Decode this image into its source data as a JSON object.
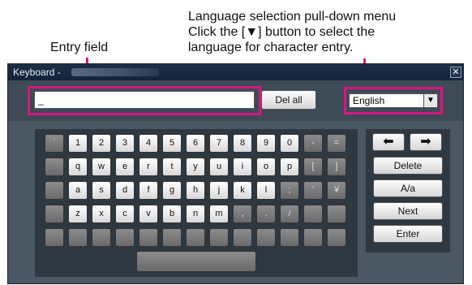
{
  "callouts": {
    "entry_field": "Entry field",
    "language_line1": "Language selection pull-down menu",
    "language_line2": "Click the [▼] button to select the",
    "language_line3": "language for character entry."
  },
  "window": {
    "title": "Keyboard -",
    "close_symbol": "✕"
  },
  "entry": {
    "value": "_"
  },
  "del_all_label": "Del all",
  "language": {
    "selected": "English",
    "arrow": "▼"
  },
  "keys": {
    "row1": [
      "`",
      "1",
      "2",
      "3",
      "4",
      "5",
      "6",
      "7",
      "8",
      "9",
      "0",
      "-",
      "="
    ],
    "row2": [
      "",
      "q",
      "w",
      "e",
      "r",
      "t",
      "y",
      "u",
      "i",
      "o",
      "p",
      "[",
      "]"
    ],
    "row3": [
      "",
      "a",
      "s",
      "d",
      "f",
      "g",
      "h",
      "j",
      "k",
      "l",
      ";",
      "'",
      "¥"
    ],
    "row4": [
      "",
      "z",
      "x",
      "c",
      "v",
      "b",
      "n",
      "m",
      ",",
      ".",
      "/",
      "",
      ""
    ],
    "row5": [
      "",
      "",
      "",
      "",
      "",
      "",
      "",
      "",
      "",
      "",
      "",
      "",
      ""
    ]
  },
  "right_buttons": {
    "left_arrow": "⬅",
    "right_arrow": "➡",
    "delete": "Delete",
    "case": "A/a",
    "next": "Next",
    "enter": "Enter"
  },
  "colors": {
    "highlight": "#d6187f",
    "window_bg": "#4b5762",
    "titlebar": "#1c2e46"
  }
}
